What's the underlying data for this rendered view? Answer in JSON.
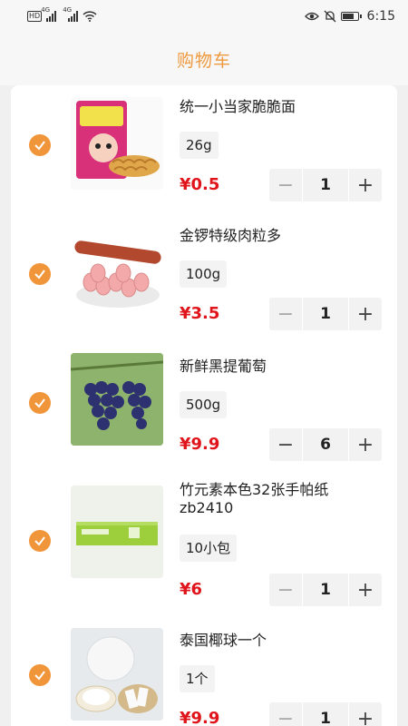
{
  "status_bar": {
    "hd_label": "HD",
    "network_1": "4G",
    "network_2": "4G",
    "time": "6:15",
    "battery_level": 0.85
  },
  "header": {
    "title": "购物车"
  },
  "cart_items": [
    {
      "name": "统一小当家脆脆面",
      "spec": "26g",
      "price": "¥0.5",
      "quantity": "1",
      "checked": true,
      "thumb_icon": "noodle-snack-image"
    },
    {
      "name": "金锣特级肉粒多",
      "spec": "100g",
      "price": "¥3.5",
      "quantity": "1",
      "checked": true,
      "thumb_icon": "sausage-image"
    },
    {
      "name": "新鲜黑提葡萄",
      "spec": "500g",
      "price": "¥9.9",
      "quantity": "6",
      "checked": true,
      "thumb_icon": "grape-image"
    },
    {
      "name": "竹元素本色32张手帕纸zb2410",
      "spec": "10小包",
      "price": "¥6",
      "quantity": "1",
      "checked": true,
      "thumb_icon": "tissue-box-image"
    },
    {
      "name": "泰国椰球一个",
      "spec": "1个",
      "price": "¥9.9",
      "quantity": "1",
      "checked": true,
      "thumb_icon": "coconut-image"
    }
  ],
  "colors": {
    "accent": "#f0953a",
    "title": "#ee9a3e",
    "price": "#e0151b"
  }
}
